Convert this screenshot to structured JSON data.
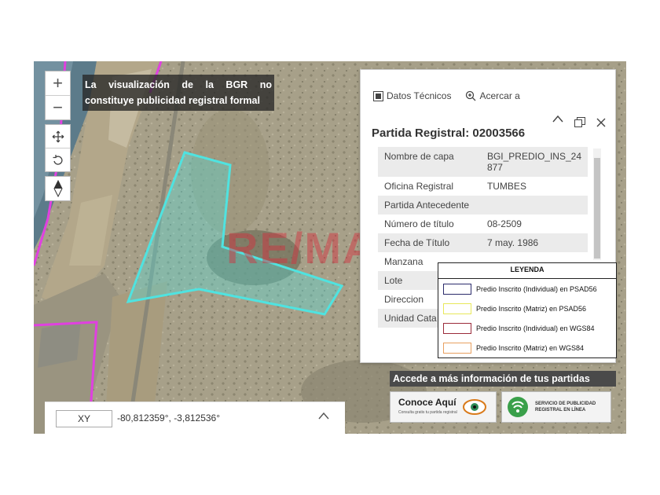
{
  "map": {
    "disclaimer": "La visualización de la BGR no constituye publicidad registral formal",
    "watermark": "RE/MAX",
    "controls": {
      "zoom_in": "+",
      "zoom_out": "−"
    }
  },
  "popup": {
    "tools": {
      "datos_tecnicos": "Datos Técnicos",
      "acercar": "Acercar a"
    },
    "title": "Partida Registral: 02003566",
    "attributes": [
      {
        "key": "Nombre de capa",
        "value": "BGI_PREDIO_INS_24 877"
      },
      {
        "key": "Oficina Registral",
        "value": "TUMBES"
      },
      {
        "key": "Partida Antecedente",
        "value": ""
      },
      {
        "key": "Número de título",
        "value": "08-2509"
      },
      {
        "key": "Fecha de Título",
        "value": "7 may. 1986"
      },
      {
        "key": "Manzana",
        "value": ""
      },
      {
        "key": "Lote",
        "value": ""
      },
      {
        "key": "Direccion",
        "value": ""
      },
      {
        "key": "Unidad Cata",
        "value": ""
      }
    ]
  },
  "legend": {
    "title": "LEYENDA",
    "items": [
      {
        "label": "Predio Inscrito (Individual) en PSAD56",
        "color": "#2b2b6b"
      },
      {
        "label": "Predio Inscrito (Matriz) en PSAD56",
        "color": "#e8e85a"
      },
      {
        "label": "Predio Inscrito (Individual) en WGS84",
        "color": "#9b2b3b"
      },
      {
        "label": "Predio Inscrito (Matriz) en WGS84",
        "color": "#e8a060"
      }
    ]
  },
  "banner": {
    "heading": "Accede a más información de tus partidas",
    "conoce": "Conoce Aquí",
    "conoce_sub": "Consulta gratis tu partida registral",
    "servicio": "SERVICIO DE PUBLICIDAD REGISTRAL EN LÍNEA"
  },
  "coords": {
    "label": "XY",
    "value": "-80,812359°, -3,812536°"
  },
  "colors": {
    "parcel": "#4fe3e0",
    "boundary": "#e040e0"
  }
}
